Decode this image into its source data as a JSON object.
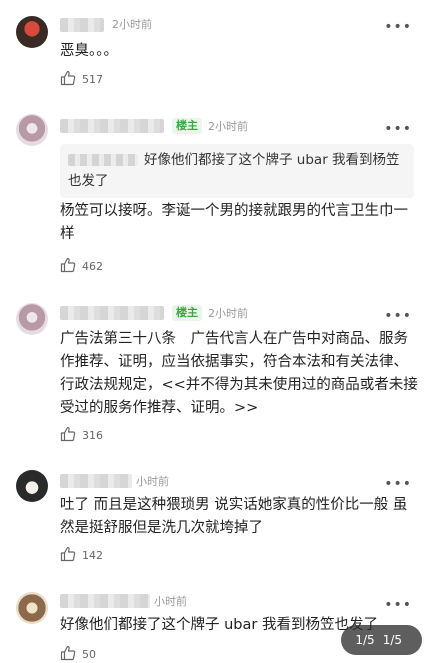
{
  "comments": [
    {
      "time": "2小时前",
      "text": "恶臭。。。",
      "likes": "517"
    },
    {
      "badge": "楼主",
      "time": "2小时前",
      "quote": "好像他们都接了这个牌子 ubar 我看到杨笠也发了",
      "text": "杨笠可以接呀。李诞一个男的接就跟男的代言卫生巾一样",
      "likes": "462"
    },
    {
      "badge": "楼主",
      "time": "2小时前",
      "text": "广告法第三十八条　广告代言人在广告中对商品、服务作推荐、证明，应当依据事实，符合本法和有关法律、行政法规规定，<<并不得为其未使用过的商品或者未接受过的服务作推荐、证明。>>",
      "likes": "316"
    },
    {
      "time": "小时前",
      "text": "吐了 而且是这种猥琐男 说实话她家真的性价比一般 虽然是挺舒服但是洗几次就垮掉了",
      "likes": "142"
    },
    {
      "time": "小时前",
      "text": "好像他们都接了这个牌子 ubar 我看到杨笠也发了",
      "likes": "50"
    }
  ],
  "more_label": "•••",
  "pager": {
    "a": "1/5",
    "b": "1/5"
  }
}
